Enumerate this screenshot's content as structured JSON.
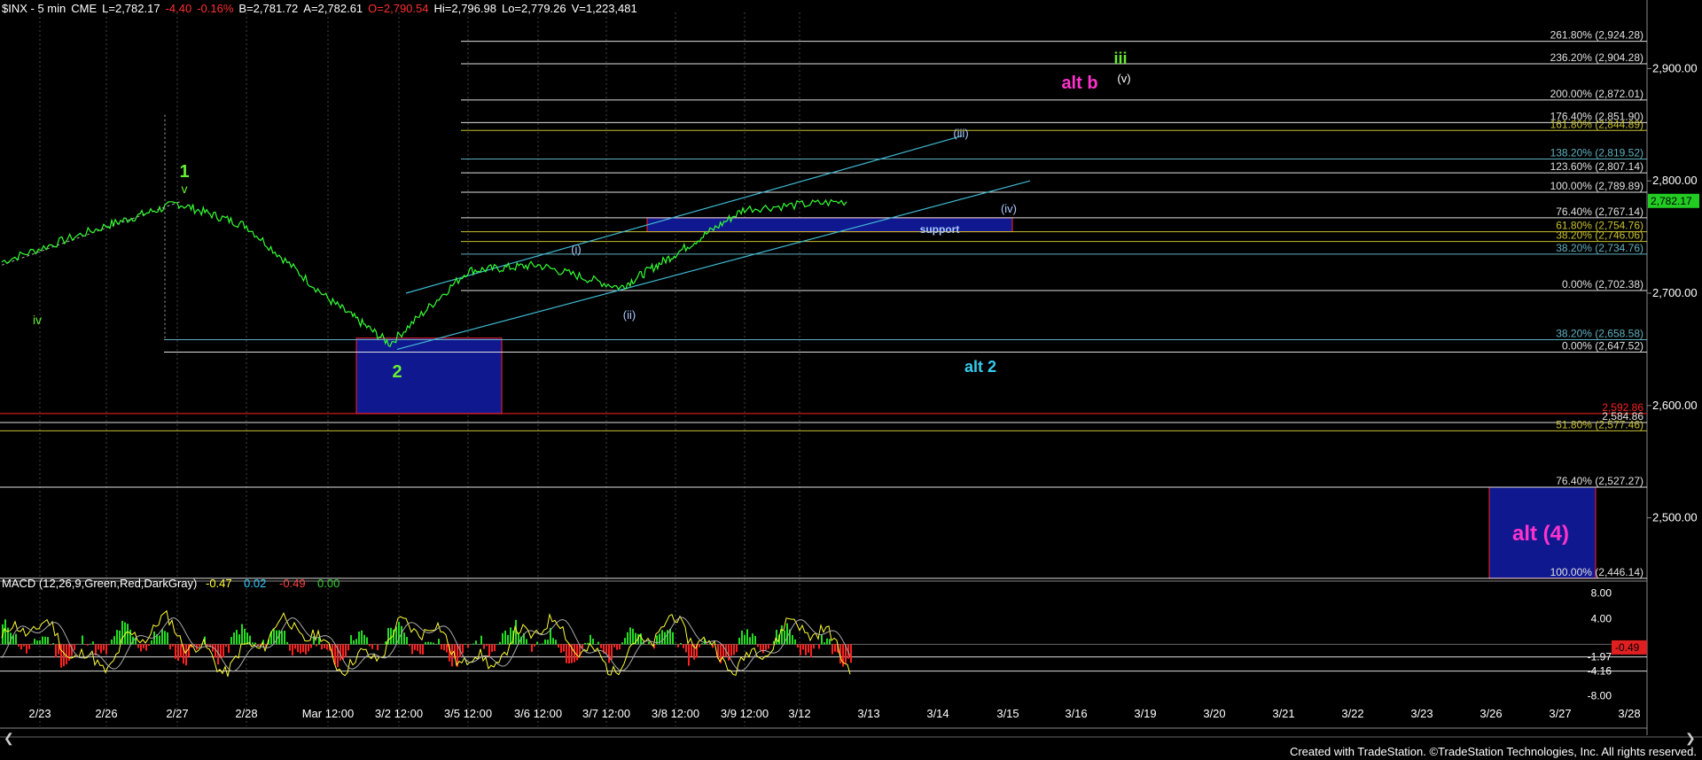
{
  "header": {
    "symbol": "$INX - 5 min",
    "exchange": "CME",
    "last": "L=2,782.17",
    "change": "-4.40",
    "change_pct": "-0.16%",
    "bid": "B=2,781.72",
    "ask": "A=2,782.61",
    "open": "O=2,790.54",
    "high": "Hi=2,796.98",
    "low": "Lo=2,779.26",
    "volume": "V=1,223,481"
  },
  "footer": "Created with TradeStation. ©TradeStation Technologies, Inc. All rights reserved.",
  "colors": {
    "background": "#000000",
    "price": "#33ff33",
    "fib_white": "#e0e0e0",
    "fib_cyan": "#5fb0c0",
    "fib_yellow": "#c8c030",
    "support_box": "#101890",
    "label_green": "#66ee33",
    "label_magenta": "#ff33cc",
    "label_cyan": "#33ccee",
    "label_blue": "#aac8ff",
    "last_price_tag": "#22cc22",
    "red_line": "#ff2020"
  },
  "chart_data": [
    {
      "type": "line",
      "title": "",
      "ylim": [
        2450,
        2950
      ],
      "x_ticks": [
        "2/23",
        "2/26",
        "2/27",
        "2/28",
        "Mar 12:00",
        "3/2 12:00",
        "3/5 12:00",
        "3/6 12:00",
        "3/7 12:00",
        "3/8 12:00",
        "3/9 12:00",
        "3/12",
        "3/13",
        "3/14",
        "3/15",
        "3/16",
        "3/19",
        "3/20",
        "3/21",
        "3/22",
        "3/23",
        "3/26",
        "3/27",
        "3/28"
      ],
      "y_ticks": [
        "2,900.00",
        "2,800.00",
        "2,700.00",
        "2,600.00",
        "2,500.00"
      ],
      "last_price_tag": "2,782.17",
      "series": [
        {
          "x": [
            "2/23",
            "2/26",
            "2/27",
            "2/28",
            "Mar 12:00",
            "3/2 12:00",
            "3/5 12:00",
            "3/6 12:00",
            "3/7 12:00",
            "3/8 12:00",
            "3/9 12:00",
            "3/12"
          ],
          "values": [
            2728,
            2760,
            2780,
            2760,
            2695,
            2655,
            2720,
            2725,
            2705,
            2735,
            2775,
            2782
          ]
        }
      ],
      "fib_levels": [
        {
          "label": "261.80% (2,924.28)",
          "value": 2924.28,
          "color": "white"
        },
        {
          "label": "236.20% (2,904.28)",
          "value": 2904.28,
          "color": "white"
        },
        {
          "label": "200.00% (2,872.01)",
          "value": 2872.01,
          "color": "white"
        },
        {
          "label": "176.40% (2,851.90)",
          "value": 2851.9,
          "color": "white"
        },
        {
          "label": "161.80% (2,844.89)",
          "value": 2844.89,
          "color": "yellow"
        },
        {
          "label": "138.20% (2,819.52)",
          "value": 2819.52,
          "color": "cyan"
        },
        {
          "label": "123.60% (2,807.14)",
          "value": 2807.14,
          "color": "white"
        },
        {
          "label": "100.00% (2,789.89)",
          "value": 2789.89,
          "color": "white"
        },
        {
          "label": "76.40% (2,767.14)",
          "value": 2767.14,
          "color": "white"
        },
        {
          "label": "61.80% (2,754.76)",
          "value": 2754.76,
          "color": "yellow"
        },
        {
          "label": "38.20% (2,746.06)",
          "value": 2746.06,
          "color": "yellow"
        },
        {
          "label": "38.20% (2,734.76)",
          "value": 2734.76,
          "color": "cyan"
        },
        {
          "label": "0.00% (2,702.38)",
          "value": 2702.38,
          "color": "white"
        },
        {
          "label": "38.20% (2,658.58)",
          "value": 2658.58,
          "color": "cyan"
        },
        {
          "label": "0.00% (2,647.52)",
          "value": 2647.52,
          "color": "white"
        },
        {
          "label": "2,592.86",
          "value": 2592.86,
          "color": "red"
        },
        {
          "label": "2,584.86",
          "value": 2584.86,
          "color": "white"
        },
        {
          "label": "51.80% (2,577.46)",
          "value": 2577.46,
          "color": "yellow"
        },
        {
          "label": "76.40% (2,527.27)",
          "value": 2527.27,
          "color": "white"
        },
        {
          "label": "100.00% (2,446.14)",
          "value": 2446.14,
          "color": "white"
        }
      ],
      "annotations": [
        {
          "text": "iii",
          "color": "green"
        },
        {
          "text": "alt b",
          "color": "magenta"
        },
        {
          "text": "(v)",
          "color": "white"
        },
        {
          "text": "(iii)",
          "color": "blue"
        },
        {
          "text": "(iv)",
          "color": "blue"
        },
        {
          "text": "(i)",
          "color": "blue"
        },
        {
          "text": "(ii)",
          "color": "blue"
        },
        {
          "text": "1",
          "color": "green"
        },
        {
          "text": "v",
          "color": "green"
        },
        {
          "text": "iv",
          "color": "green"
        },
        {
          "text": "2",
          "color": "green"
        },
        {
          "text": "alt 2",
          "color": "cyan"
        },
        {
          "text": "support",
          "color": "blue"
        },
        {
          "text": "alt (4)",
          "color": "magenta"
        }
      ]
    },
    {
      "type": "line",
      "title": "MACD (12,26,9,Green,Red,DarkGray)",
      "values_readout": [
        "-0.47",
        "0.02",
        "-0.49",
        "0.00"
      ],
      "y_ticks": [
        "8.00",
        "4.00",
        "-1.97",
        "-4.16",
        "-8.00"
      ],
      "right_tag": "-0.49",
      "ylim": [
        -10,
        9
      ]
    }
  ]
}
